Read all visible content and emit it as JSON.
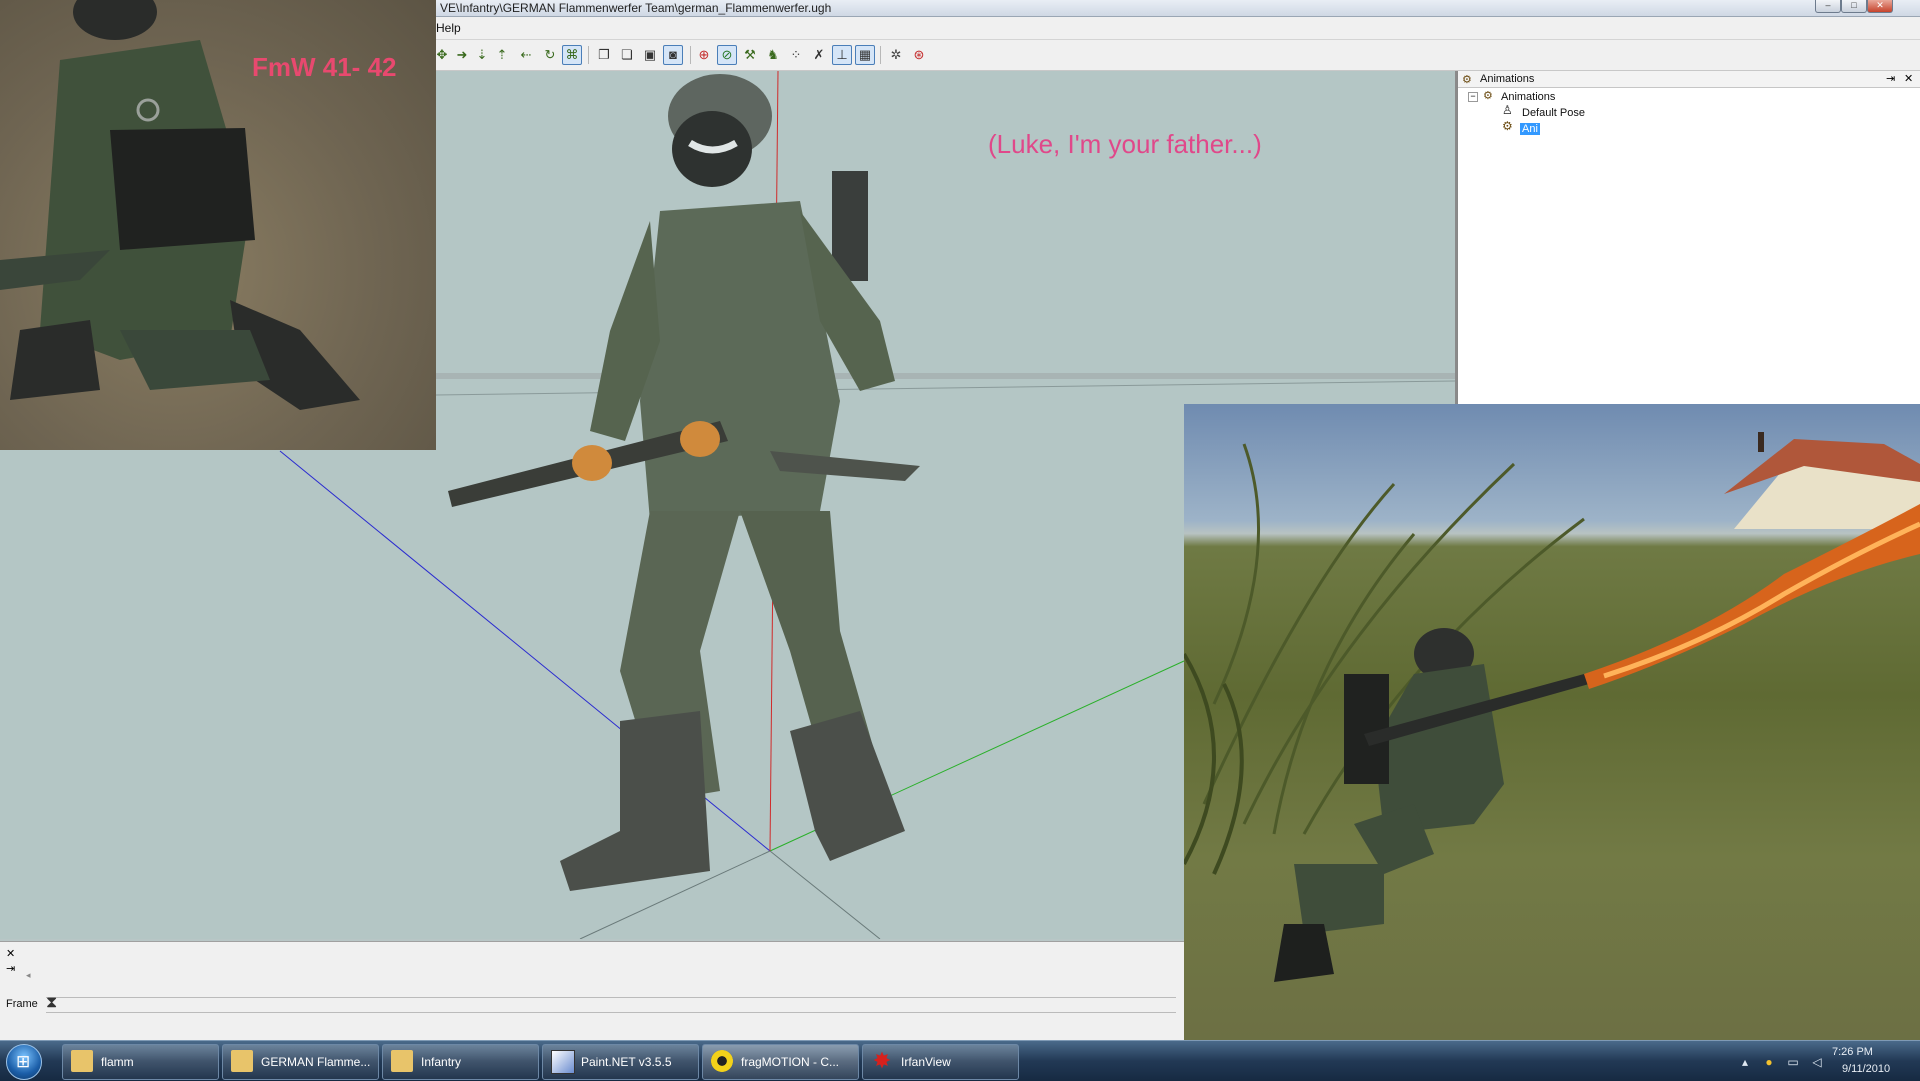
{
  "window": {
    "title": "VE\\Infantry\\GERMAN Flammenwerfer Team\\german_Flammenwerfer.ugh",
    "menu_help": "Help"
  },
  "viewport": {
    "overlay_text": "(Luke, I'm your father...)"
  },
  "animations_panel": {
    "header": "Animations",
    "tree_root": "Animations",
    "items": [
      "Default Pose",
      "Ani"
    ],
    "selected": "Ani"
  },
  "timeline": {
    "frame_label": "Frame"
  },
  "overlay_left": {
    "label": "FmW 41- 42"
  },
  "taskbar": {
    "tasks": [
      {
        "label": "flamm",
        "icon": "folder-icon"
      },
      {
        "label": "GERMAN Flamme...",
        "icon": "folder-icon"
      },
      {
        "label": "Infantry",
        "icon": "folder-icon"
      },
      {
        "label": "Paint.NET v3.5.5",
        "icon": "paintnet-icon"
      },
      {
        "label": "fragMOTION - C...",
        "icon": "fragmotion-icon"
      },
      {
        "label": "IrfanView",
        "icon": "irfanview-icon"
      }
    ],
    "clock_time": "7:26 PM",
    "clock_date": "9/11/2010"
  },
  "colors": {
    "viewport_bg": "#b4c6c5",
    "overlay_pink": "#e0488a",
    "label_red": "#e8496f",
    "selection": "#3399ff"
  }
}
